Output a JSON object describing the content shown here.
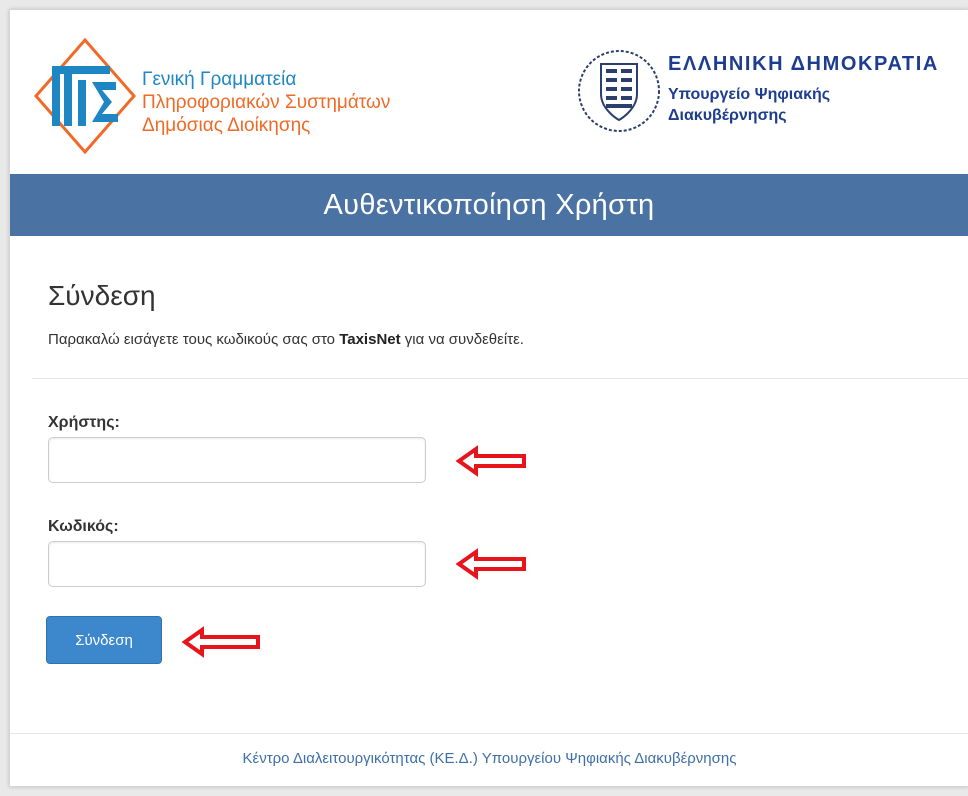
{
  "header": {
    "gsis": {
      "line1": "Γενική Γραμματεία",
      "line2": "Πληροφοριακών Συστημάτων",
      "line3": "Δημόσιας Διοίκησης"
    },
    "ministry": {
      "title": "ΕΛΛΗΝΙΚΗ ΔΗΜΟΚΡΑΤΙΑ",
      "line1": "Υπουργείο Ψηφιακής",
      "line2": "Διακυβέρνησης"
    }
  },
  "banner": {
    "title": "Αυθεντικοποίηση Χρήστη"
  },
  "form": {
    "title": "Σύνδεση",
    "instructions_before": "Παρακαλώ εισάγετε τους κωδικούς σας στο ",
    "instructions_bold": "TaxisNet",
    "instructions_after": " για να συνδεθείτε.",
    "username_label": "Χρήστης:",
    "username_value": "",
    "password_label": "Κωδικός:",
    "password_value": "",
    "submit_label": "Σύνδεση"
  },
  "annotations": {
    "arrow_color": "#e8141c",
    "arrow_icon": "arrow-left-outline-icon"
  },
  "footer": {
    "text": "Κέντρο Διαλειτουργικότητας (ΚΕ.Δ.) Υπουργείου Ψηφιακής Διακυβέρνησης"
  },
  "colors": {
    "banner": "#4a72a3",
    "button": "#3d87cc",
    "brand_blue": "#1d3d8f",
    "brand_orange": "#f06a26"
  }
}
